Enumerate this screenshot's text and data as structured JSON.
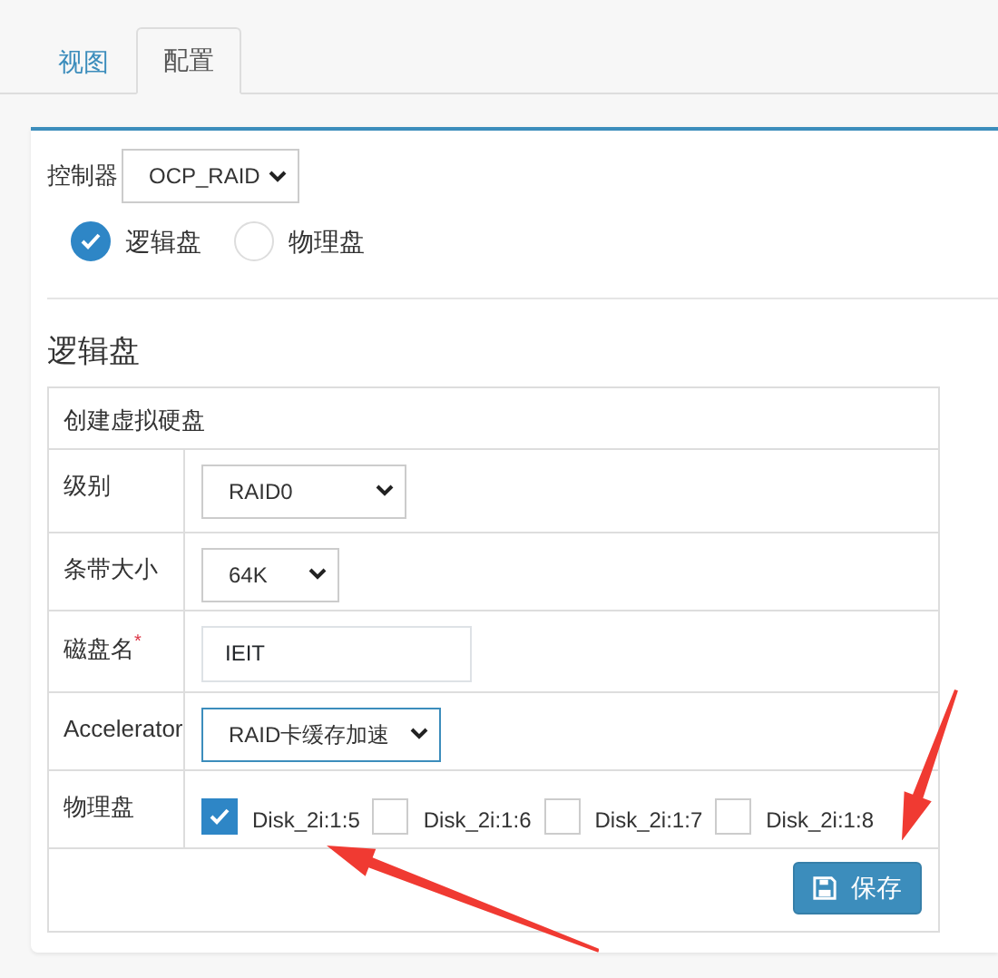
{
  "tabs": [
    {
      "label": "视图",
      "selected": false
    },
    {
      "label": "配置",
      "selected": true
    }
  ],
  "controller": {
    "label": "控制器",
    "value": "OCP_RAID"
  },
  "disk_type": [
    {
      "label": "逻辑盘",
      "selected": true
    },
    {
      "label": "物理盘",
      "selected": false
    }
  ],
  "section_title": "逻辑盘",
  "form": {
    "title": "创建虚拟硬盘",
    "rows": [
      {
        "kind": "select",
        "label": "级别",
        "value": "RAID0",
        "focused": false
      },
      {
        "kind": "select",
        "label": "条带大小",
        "value": "64K",
        "focused": false
      },
      {
        "kind": "input",
        "label": "磁盘名",
        "required_mark": "*",
        "value": "IEIT"
      },
      {
        "kind": "select",
        "label": "Accelerator",
        "value": "RAID卡缓存加速",
        "focused": true
      },
      {
        "kind": "disks",
        "label": "物理盘",
        "disks": [
          {
            "label": "Disk_2i:1:5",
            "checked": true
          },
          {
            "label": "Disk_2i:1:6",
            "checked": false
          },
          {
            "label": "Disk_2i:1:7",
            "checked": false
          },
          {
            "label": "Disk_2i:1:8",
            "checked": false
          }
        ]
      }
    ],
    "save_button": "保存"
  },
  "annotations": [
    {
      "kind": "arrow"
    },
    {
      "kind": "arrow"
    }
  ]
}
